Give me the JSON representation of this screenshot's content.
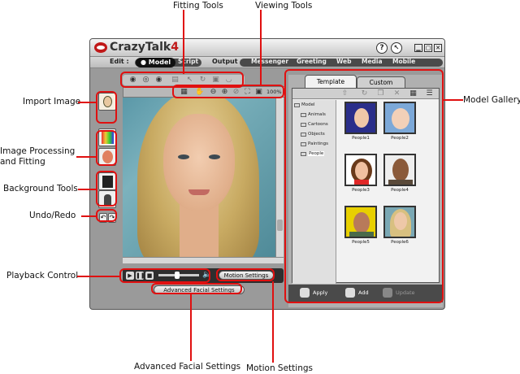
{
  "callouts": {
    "fitting_tools": "Fitting Tools",
    "viewing_tools": "Viewing Tools",
    "import_image": "Import Image",
    "image_processing_line1": "Image Processing",
    "image_processing_line2": "and Fitting",
    "background_tools": "Background Tools",
    "undo_redo": "Undo/Redo",
    "playback_control": "Playback Control",
    "model_gallery": "Model Gallery",
    "advanced_facial_settings": "Advanced Facial Settings",
    "motion_settings": "Motion Settings"
  },
  "window": {
    "title_main": "CrazyTalk",
    "title_version": "4",
    "help_button": "?",
    "menu": {
      "edit_label": "Edit :",
      "edit_tabs": [
        "Model",
        "Script"
      ],
      "output_label": "Output :",
      "output_tabs": [
        "Messenger",
        "Greeting",
        "Web",
        "Media",
        "Mobile"
      ]
    },
    "zoom": "100%",
    "motion_settings_button": "Motion Settings",
    "advanced_facial_button": "Advanced Facial Settings",
    "gallery": {
      "tabs": [
        "Template",
        "Custom"
      ],
      "tree_root": "Model",
      "tree_items": [
        "Animals",
        "Cartoons",
        "Objects",
        "Paintings",
        "People"
      ],
      "thumbnails": [
        "People1",
        "People2",
        "People3",
        "People4",
        "People5",
        "People6"
      ],
      "actions": [
        "Apply",
        "Add",
        "Update"
      ]
    }
  },
  "colors": {
    "callout_red": "#e01010",
    "window_gray": "#9a9a9a",
    "logo_red": "#c01818"
  }
}
